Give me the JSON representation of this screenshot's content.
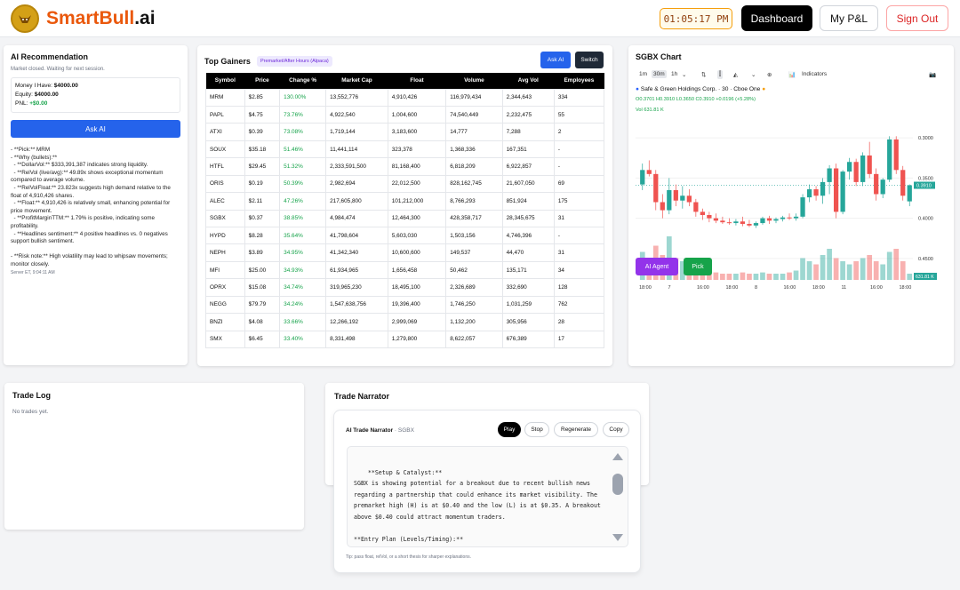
{
  "header": {
    "brand": "SmartBull.ai",
    "brand_part1": "SmartBull",
    "brand_part2": ".ai",
    "clock": "01:05:17 PM",
    "nav": {
      "dashboard": "Dashboard",
      "my_pnl": "My P&L",
      "sign_out": "Sign Out"
    }
  },
  "ai_recommendation": {
    "title": "AI Recommendation",
    "status": "Market closed. Waiting for next session.",
    "money_label": "Money I Have:",
    "money_value": "$4000.00",
    "equity_label": "Equity:",
    "equity_value": "$4000.00",
    "pnl_label": "PNL:",
    "pnl_value": "+$0.00",
    "ask_button": "Ask AI",
    "text": "- **Pick:** MRM\n- **Why (bullets):**\n  - **DollarVol:** $333,391,387 indicates strong liquidity.\n  - **RelVol (live/avg):** 49.89x shows exceptional momentum compared to average volume.\n  - **RelVolFloat:** 23.823x suggests high demand relative to the float of 4,910,426 shares.\n  - **Float:** 4,910,426 is relatively small, enhancing potential for price movement.\n  - **ProfitMarginTTM:** 1.79% is positive, indicating some profitability.\n  - **Headlines sentiment:** 4 positive headlines vs. 0 negatives support bullish sentiment.\n\n- **Risk note:** High volatility may lead to whipsaw movements; monitor closely.",
    "timestamp": "Server ET, 9:04:11 AM"
  },
  "top_gainers": {
    "title": "Top Gainers",
    "badge": "Premarket/After Hours (Alpaca)",
    "ask_button": "Ask AI",
    "switch_button": "Switch",
    "columns": [
      "Symbol",
      "Price",
      "Change %",
      "Market Cap",
      "Float",
      "Volume",
      "Avg Vol",
      "Employees"
    ],
    "rows": [
      [
        "MRM",
        "$2.85",
        "130.00%",
        "13,552,776",
        "4,910,426",
        "116,979,434",
        "2,344,643",
        "334"
      ],
      [
        "PAPL",
        "$4.75",
        "73.76%",
        "4,922,540",
        "1,004,600",
        "74,540,449",
        "2,232,475",
        "55"
      ],
      [
        "ATXI",
        "$0.39",
        "73.08%",
        "1,719,144",
        "3,183,600",
        "14,777",
        "7,288",
        "2"
      ],
      [
        "SOUX",
        "$35.18",
        "51.46%",
        "11,441,114",
        "323,378",
        "1,368,336",
        "167,351",
        "-"
      ],
      [
        "HTFL",
        "$29.45",
        "51.32%",
        "2,333,591,500",
        "81,168,400",
        "6,818,209",
        "6,922,857",
        "-"
      ],
      [
        "ORIS",
        "$0.19",
        "50.39%",
        "2,982,694",
        "22,012,500",
        "828,162,745",
        "21,607,050",
        "69"
      ],
      [
        "ALEC",
        "$2.11",
        "47.26%",
        "217,605,800",
        "101,212,000",
        "8,766,293",
        "851,924",
        "175"
      ],
      [
        "SGBX",
        "$0.37",
        "38.85%",
        "4,984,474",
        "12,464,300",
        "428,358,717",
        "28,345,675",
        "31"
      ],
      [
        "HYPD",
        "$8.28",
        "35.64%",
        "41,798,604",
        "5,603,030",
        "1,503,156",
        "4,746,396",
        "-"
      ],
      [
        "NEPH",
        "$3.89",
        "34.95%",
        "41,342,340",
        "10,600,600",
        "149,537",
        "44,470",
        "31"
      ],
      [
        "MFI",
        "$25.00",
        "34.93%",
        "61,934,965",
        "1,656,458",
        "50,462",
        "135,171",
        "34"
      ],
      [
        "OPRX",
        "$15.08",
        "34.74%",
        "319,965,230",
        "18,495,100",
        "2,326,689",
        "332,690",
        "128"
      ],
      [
        "NEGG",
        "$79.79",
        "34.24%",
        "1,547,638,756",
        "19,396,400",
        "1,746,250",
        "1,031,259",
        "762"
      ],
      [
        "BNZI",
        "$4.08",
        "33.66%",
        "12,266,192",
        "2,999,069",
        "1,132,200",
        "305,956",
        "28"
      ],
      [
        "SMX",
        "$6.45",
        "33.40%",
        "8,331,498",
        "1,279,800",
        "8,622,057",
        "676,389",
        "17"
      ]
    ]
  },
  "chart_card": {
    "title": "SGBX Chart",
    "toolbar": {
      "tf1": "1m",
      "tf2": "30m",
      "tf3": "1h",
      "indicators": "Indicators"
    },
    "symbol_line": "Safe & Green Holdings Corp. · 30 · Cboe One",
    "ohlc": "O0.3701 H0.3910 L0.3650 C0.3910 +0.0196 (+5.28%)",
    "volume": "Vol 631.81 K",
    "price_labels": [
      "0.4500",
      "0.4000",
      "0.3500",
      "0.3000"
    ],
    "last_price": "0.3910",
    "last_volume": "631.81 K",
    "time_labels": [
      "18:00",
      "7",
      "16:00",
      "18:00",
      "8",
      "16:00",
      "18:00",
      "11",
      "16:00",
      "18:00"
    ],
    "ai_agent_button": "AI Agent",
    "pick_button": "Pick",
    "colors": {
      "up": "#26a69a",
      "down": "#ef5350"
    },
    "tv_logo": "TV"
  },
  "chart_data": {
    "type": "candlestick",
    "title": "SGBX Chart",
    "ylim": [
      0.28,
      0.47
    ],
    "y_ticks": [
      0.3,
      0.35,
      0.4,
      0.45
    ],
    "last_close": 0.391,
    "candles": [
      [
        0.392,
        0.418,
        0.385,
        0.41
      ],
      [
        0.41,
        0.422,
        0.402,
        0.405
      ],
      [
        0.405,
        0.41,
        0.36,
        0.37
      ],
      [
        0.37,
        0.38,
        0.35,
        0.36
      ],
      [
        0.36,
        0.4,
        0.355,
        0.385
      ],
      [
        0.385,
        0.392,
        0.365,
        0.372
      ],
      [
        0.372,
        0.39,
        0.362,
        0.378
      ],
      [
        0.378,
        0.386,
        0.365,
        0.37
      ],
      [
        0.37,
        0.374,
        0.352,
        0.358
      ],
      [
        0.358,
        0.362,
        0.348,
        0.354
      ],
      [
        0.354,
        0.358,
        0.345,
        0.35
      ],
      [
        0.35,
        0.356,
        0.344,
        0.347
      ],
      [
        0.347,
        0.352,
        0.343,
        0.345
      ],
      [
        0.345,
        0.35,
        0.342,
        0.344
      ],
      [
        0.344,
        0.349,
        0.341,
        0.346
      ],
      [
        0.346,
        0.352,
        0.34,
        0.343
      ],
      [
        0.343,
        0.348,
        0.339,
        0.341
      ],
      [
        0.341,
        0.346,
        0.338,
        0.344
      ],
      [
        0.344,
        0.352,
        0.342,
        0.35
      ],
      [
        0.35,
        0.353,
        0.343,
        0.347
      ],
      [
        0.347,
        0.351,
        0.344,
        0.349
      ],
      [
        0.349,
        0.353,
        0.346,
        0.351
      ],
      [
        0.351,
        0.356,
        0.348,
        0.35
      ],
      [
        0.35,
        0.356,
        0.347,
        0.352
      ],
      [
        0.352,
        0.38,
        0.35,
        0.376
      ],
      [
        0.376,
        0.392,
        0.37,
        0.386
      ],
      [
        0.386,
        0.39,
        0.372,
        0.378
      ],
      [
        0.378,
        0.4,
        0.368,
        0.395
      ],
      [
        0.395,
        0.416,
        0.38,
        0.412
      ],
      [
        0.412,
        0.418,
        0.35,
        0.358
      ],
      [
        0.358,
        0.41,
        0.355,
        0.408
      ],
      [
        0.408,
        0.425,
        0.398,
        0.42
      ],
      [
        0.42,
        0.424,
        0.39,
        0.395
      ],
      [
        0.395,
        0.432,
        0.39,
        0.428
      ],
      [
        0.428,
        0.445,
        0.4,
        0.405
      ],
      [
        0.405,
        0.412,
        0.372,
        0.38
      ],
      [
        0.38,
        0.4,
        0.375,
        0.398
      ],
      [
        0.398,
        0.452,
        0.395,
        0.448
      ],
      [
        0.448,
        0.452,
        0.405,
        0.41
      ],
      [
        0.41,
        0.415,
        0.372,
        0.378
      ],
      [
        0.371,
        0.392,
        0.365,
        0.391
      ]
    ],
    "volumes": [
      0.45,
      0.3,
      0.55,
      0.4,
      0.7,
      0.35,
      0.3,
      0.25,
      0.2,
      0.18,
      0.15,
      0.12,
      0.1,
      0.1,
      0.1,
      0.12,
      0.1,
      0.1,
      0.12,
      0.1,
      0.1,
      0.1,
      0.12,
      0.15,
      0.35,
      0.3,
      0.25,
      0.4,
      0.5,
      0.35,
      0.3,
      0.25,
      0.3,
      0.35,
      0.4,
      0.3,
      0.25,
      0.45,
      0.5,
      0.3,
      0.1
    ]
  },
  "trade_log": {
    "title": "Trade Log",
    "empty": "No trades yet."
  },
  "trade_narrator": {
    "title": "Trade Narrator",
    "inner_title": "AI Trade Narrator",
    "symbol": "· SGBX",
    "buttons": {
      "play": "Play",
      "stop": "Stop",
      "regenerate": "Regenerate",
      "copy": "Copy"
    },
    "text": "**Setup & Catalyst:**\nSGBX is showing potential for a breakout due to recent bullish news regarding a partnership that could enhance its market visibility. The premarket high (H) is at $0.40 and the low (L) is at $0.35. A breakout above $0.40 could attract momentum traders.\n\n**Entry Plan (Levels/Timing):**\nI will look to enter a long position if SGBX breaks above the premarket high of $0.40 with strong volume. Ideally, this entry",
    "tip": "Tip: pass float, relVol, or a short thesis for sharper explanations."
  }
}
